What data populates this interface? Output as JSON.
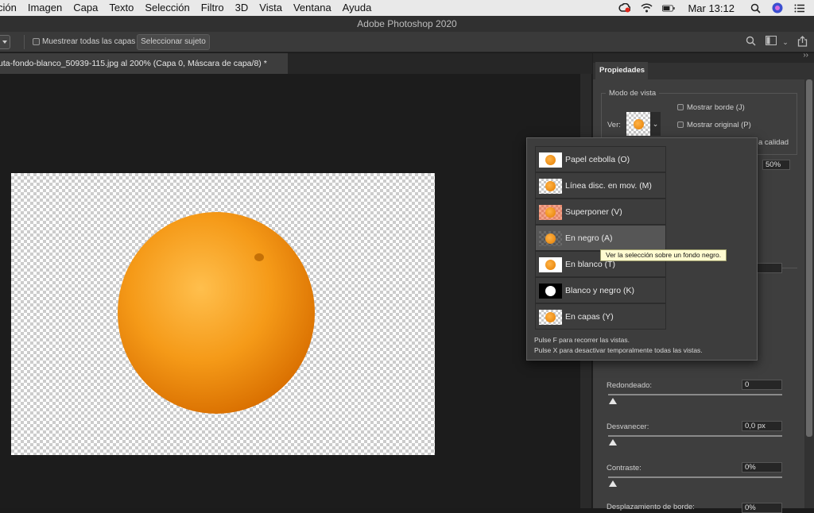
{
  "menubar": {
    "items": [
      "ción",
      "Imagen",
      "Capa",
      "Texto",
      "Selección",
      "Filtro",
      "3D",
      "Vista",
      "Ventana",
      "Ayuda"
    ],
    "clock": "Mar 13:12",
    "icons": [
      "creative-cloud-icon",
      "wifi-icon",
      "battery-icon",
      "search-icon",
      "siri-icon",
      "control-center-icon"
    ]
  },
  "window": {
    "title": "Adobe Photoshop 2020"
  },
  "options_bar": {
    "sample_all_layers_label": "Muestrear todas las capas",
    "sample_all_layers_checked": false,
    "select_subject_label": "Seleccionar sujeto",
    "icons": [
      "search-icon",
      "workspace-icon",
      "share-icon"
    ]
  },
  "document": {
    "tab_title": "uta-fondo-blanco_50939-115.jpg al 200% (Capa 0, Máscara de capa/8) *"
  },
  "properties": {
    "tab_label": "Propiedades",
    "view_mode_title": "Modo de vista",
    "view_label": "Ver:",
    "show_edge_label": "Mostrar borde (J)",
    "show_original_label": "Mostrar original (P)",
    "high_quality_partial": "a calidad",
    "opacity_value": "50%",
    "sliders": [
      {
        "label": "Redondeado:",
        "value": "0"
      },
      {
        "label": "Desvanecer:",
        "value": "0,0 px"
      },
      {
        "label": "Contraste:",
        "value": "0%"
      },
      {
        "label": "Desplazamiento de borde:",
        "value": "0%"
      }
    ]
  },
  "view_menu": {
    "options": [
      {
        "label": "Papel cebolla (O)",
        "thumb": "onion"
      },
      {
        "label": "Línea disc. en mov. (M)",
        "thumb": "ants"
      },
      {
        "label": "Superponer (V)",
        "thumb": "overlay"
      },
      {
        "label": "En negro (A)",
        "thumb": "black",
        "highlighted": true
      },
      {
        "label": "En blanco (T)",
        "thumb": "white"
      },
      {
        "label": "Blanco y negro (K)",
        "thumb": "bw"
      },
      {
        "label": "En capas (Y)",
        "thumb": "layers"
      }
    ],
    "hint_f": "Pulse F para recorrer las vistas.",
    "hint_x": "Pulse X para desactivar temporalmente todas las vistas."
  },
  "tooltip": "Ver la selección sobre un fondo negro.",
  "colors": {
    "orange": "#f39a1e",
    "highlight": "#565656",
    "tooltip_bg": "#fffbd1"
  }
}
